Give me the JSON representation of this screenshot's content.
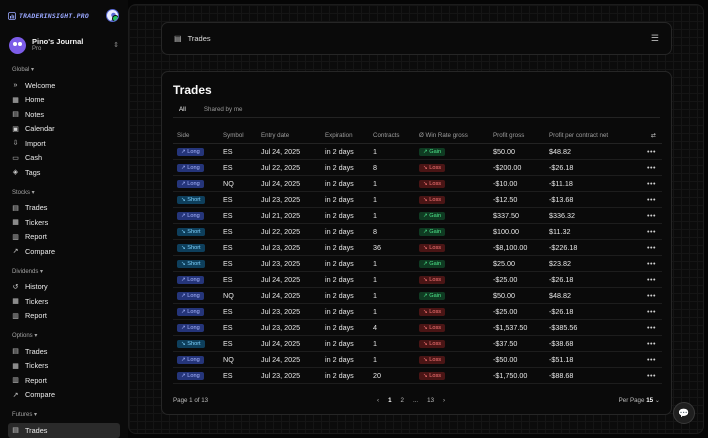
{
  "brand": {
    "name": "TRADERINSIGHT.PRO"
  },
  "journal": {
    "title": "Pino's Journal",
    "plan": "Pro"
  },
  "sidebar": {
    "sections": [
      {
        "label": "Global ▾",
        "items": [
          {
            "label": "Welcome",
            "icon": "chevrons-right-icon",
            "glyph": "»"
          },
          {
            "label": "Home",
            "icon": "home-icon",
            "glyph": "▦"
          },
          {
            "label": "Notes",
            "icon": "notes-icon",
            "glyph": "▤"
          },
          {
            "label": "Calendar",
            "icon": "calendar-icon",
            "glyph": "▣"
          },
          {
            "label": "Import",
            "icon": "import-icon",
            "glyph": "⇩"
          },
          {
            "label": "Cash",
            "icon": "cash-icon",
            "glyph": "▭"
          },
          {
            "label": "Tags",
            "icon": "tag-icon",
            "glyph": "◈"
          }
        ]
      },
      {
        "label": "Stocks ▾",
        "items": [
          {
            "label": "Trades",
            "icon": "trades-icon",
            "glyph": "▤"
          },
          {
            "label": "Tickers",
            "icon": "tickers-icon",
            "glyph": "▦"
          },
          {
            "label": "Report",
            "icon": "report-icon",
            "glyph": "▥"
          },
          {
            "label": "Compare",
            "icon": "compare-icon",
            "glyph": "↗"
          }
        ]
      },
      {
        "label": "Dividends ▾",
        "items": [
          {
            "label": "History",
            "icon": "history-icon",
            "glyph": "↺"
          },
          {
            "label": "Tickers",
            "icon": "tickers-icon",
            "glyph": "▦"
          },
          {
            "label": "Report",
            "icon": "report-icon",
            "glyph": "▥"
          }
        ]
      },
      {
        "label": "Options ▾",
        "items": [
          {
            "label": "Trades",
            "icon": "trades-icon",
            "glyph": "▤"
          },
          {
            "label": "Tickers",
            "icon": "tickers-icon",
            "glyph": "▦"
          },
          {
            "label": "Report",
            "icon": "report-icon",
            "glyph": "▥"
          },
          {
            "label": "Compare",
            "icon": "compare-icon",
            "glyph": "↗"
          }
        ]
      },
      {
        "label": "Futures ▾",
        "items": [
          {
            "label": "Trades",
            "icon": "trades-icon",
            "glyph": "▤",
            "active": true
          }
        ]
      }
    ]
  },
  "topbar": {
    "title": "Trades"
  },
  "trades": {
    "title": "Trades",
    "tabs": [
      "All",
      "Shared by me"
    ],
    "columns": [
      "Side",
      "Symbol",
      "Entry date",
      "Expiration",
      "Contracts",
      "Ø Win Rate gross",
      "Profit gross",
      "Profit per contract net"
    ],
    "rows": [
      {
        "side": "↗ Long",
        "symbol": "ES",
        "entry": "Jul 24, 2025",
        "exp": "in 2 days",
        "contracts": "1",
        "result": "↗ Gain",
        "profit": "$50.00",
        "ppc": "$48.82"
      },
      {
        "side": "↗ Long",
        "symbol": "ES",
        "entry": "Jul 22, 2025",
        "exp": "in 2 days",
        "contracts": "8",
        "result": "↘ Loss",
        "profit": "-$200.00",
        "ppc": "-$26.18"
      },
      {
        "side": "↗ Long",
        "symbol": "NQ",
        "entry": "Jul 24, 2025",
        "exp": "in 2 days",
        "contracts": "1",
        "result": "↘ Loss",
        "profit": "-$10.00",
        "ppc": "-$11.18"
      },
      {
        "side": "↘ Short",
        "symbol": "ES",
        "entry": "Jul 23, 2025",
        "exp": "in 2 days",
        "contracts": "1",
        "result": "↘ Loss",
        "profit": "-$12.50",
        "ppc": "-$13.68"
      },
      {
        "side": "↗ Long",
        "symbol": "ES",
        "entry": "Jul 21, 2025",
        "exp": "in 2 days",
        "contracts": "1",
        "result": "↗ Gain",
        "profit": "$337.50",
        "ppc": "$336.32"
      },
      {
        "side": "↘ Short",
        "symbol": "ES",
        "entry": "Jul 22, 2025",
        "exp": "in 2 days",
        "contracts": "8",
        "result": "↗ Gain",
        "profit": "$100.00",
        "ppc": "$11.32"
      },
      {
        "side": "↘ Short",
        "symbol": "ES",
        "entry": "Jul 23, 2025",
        "exp": "in 2 days",
        "contracts": "36",
        "result": "↘ Loss",
        "profit": "-$8,100.00",
        "ppc": "-$226.18"
      },
      {
        "side": "↘ Short",
        "symbol": "ES",
        "entry": "Jul 23, 2025",
        "exp": "in 2 days",
        "contracts": "1",
        "result": "↗ Gain",
        "profit": "$25.00",
        "ppc": "$23.82"
      },
      {
        "side": "↗ Long",
        "symbol": "ES",
        "entry": "Jul 24, 2025",
        "exp": "in 2 days",
        "contracts": "1",
        "result": "↘ Loss",
        "profit": "-$25.00",
        "ppc": "-$26.18"
      },
      {
        "side": "↗ Long",
        "symbol": "NQ",
        "entry": "Jul 24, 2025",
        "exp": "in 2 days",
        "contracts": "1",
        "result": "↗ Gain",
        "profit": "$50.00",
        "ppc": "$48.82"
      },
      {
        "side": "↗ Long",
        "symbol": "ES",
        "entry": "Jul 23, 2025",
        "exp": "in 2 days",
        "contracts": "1",
        "result": "↘ Loss",
        "profit": "-$25.00",
        "ppc": "-$26.18"
      },
      {
        "side": "↗ Long",
        "symbol": "ES",
        "entry": "Jul 23, 2025",
        "exp": "in 2 days",
        "contracts": "4",
        "result": "↘ Loss",
        "profit": "-$1,537.50",
        "ppc": "-$385.56"
      },
      {
        "side": "↘ Short",
        "symbol": "ES",
        "entry": "Jul 24, 2025",
        "exp": "in 2 days",
        "contracts": "1",
        "result": "↘ Loss",
        "profit": "-$37.50",
        "ppc": "-$38.68"
      },
      {
        "side": "↗ Long",
        "symbol": "NQ",
        "entry": "Jul 24, 2025",
        "exp": "in 2 days",
        "contracts": "1",
        "result": "↘ Loss",
        "profit": "-$50.00",
        "ppc": "-$51.18"
      },
      {
        "side": "↗ Long",
        "symbol": "ES",
        "entry": "Jul 23, 2025",
        "exp": "in 2 days",
        "contracts": "20",
        "result": "↘ Loss",
        "profit": "-$1,750.00",
        "ppc": "-$88.68"
      }
    ],
    "pagination": {
      "label": "Page 1 of 13",
      "pages": [
        "1",
        "2",
        "...",
        "13"
      ],
      "prev": "‹",
      "next": "›",
      "per_page_label": "Per Page",
      "per_page": "15"
    }
  }
}
